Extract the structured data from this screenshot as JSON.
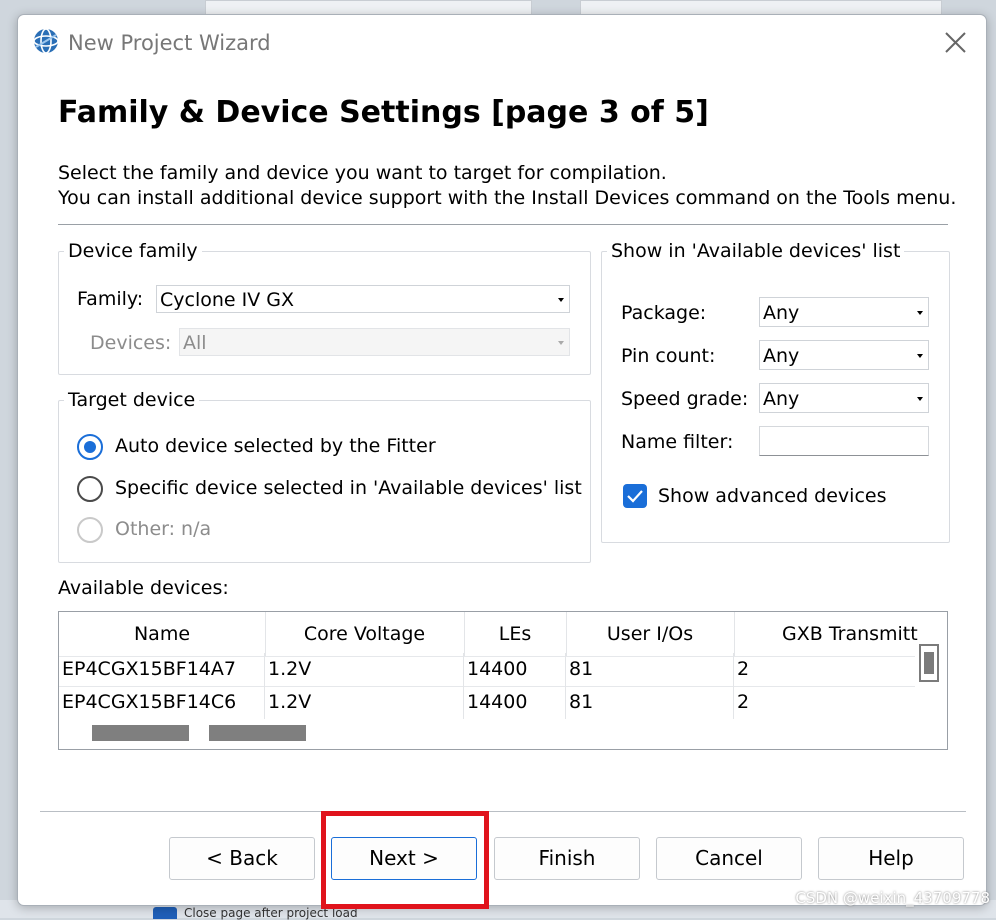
{
  "background": {
    "bottom_checkbox_label": "Close page after project load",
    "watermark": "CSDN @weixin_43709778"
  },
  "dialog": {
    "title": "New Project Wizard",
    "page_title": "Family & Device Settings [page 3 of 5]",
    "description_line1": "Select the family and device you want to target for compilation.",
    "description_line2": "You can install additional device support with the Install Devices command on the Tools menu."
  },
  "device_family": {
    "group_title": "Device family",
    "family_label": "Family:",
    "family_value": "Cyclone IV GX",
    "devices_label": "Devices:",
    "devices_value": "All"
  },
  "target_device": {
    "group_title": "Target device",
    "options": [
      {
        "label": "Auto device selected by the Fitter",
        "selected": true,
        "enabled": true
      },
      {
        "label": "Specific device selected in 'Available devices' list",
        "selected": false,
        "enabled": true
      },
      {
        "label": "Other:  n/a",
        "selected": false,
        "enabled": false
      }
    ]
  },
  "show_in_list": {
    "group_title": "Show in 'Available devices' list",
    "package_label": "Package:",
    "package_value": "Any",
    "pin_count_label": "Pin count:",
    "pin_count_value": "Any",
    "speed_grade_label": "Speed grade:",
    "speed_grade_value": "Any",
    "name_filter_label": "Name filter:",
    "name_filter_value": "",
    "show_advanced_label": "Show advanced devices",
    "show_advanced_checked": true
  },
  "available_devices": {
    "label": "Available devices:",
    "columns": [
      "Name",
      "Core Voltage",
      "LEs",
      "User I/Os",
      "GXB Transmitt"
    ],
    "rows": [
      [
        "EP4CGX15BF14A7",
        "1.2V",
        "14400",
        "81",
        "2"
      ],
      [
        "EP4CGX15BF14C6",
        "1.2V",
        "14400",
        "81",
        "2"
      ]
    ]
  },
  "buttons": {
    "back": "< Back",
    "next": "Next >",
    "finish": "Finish",
    "cancel": "Cancel",
    "help": "Help"
  },
  "colors": {
    "accent": "#1a6ed8",
    "highlight_box": "#e0131c"
  }
}
